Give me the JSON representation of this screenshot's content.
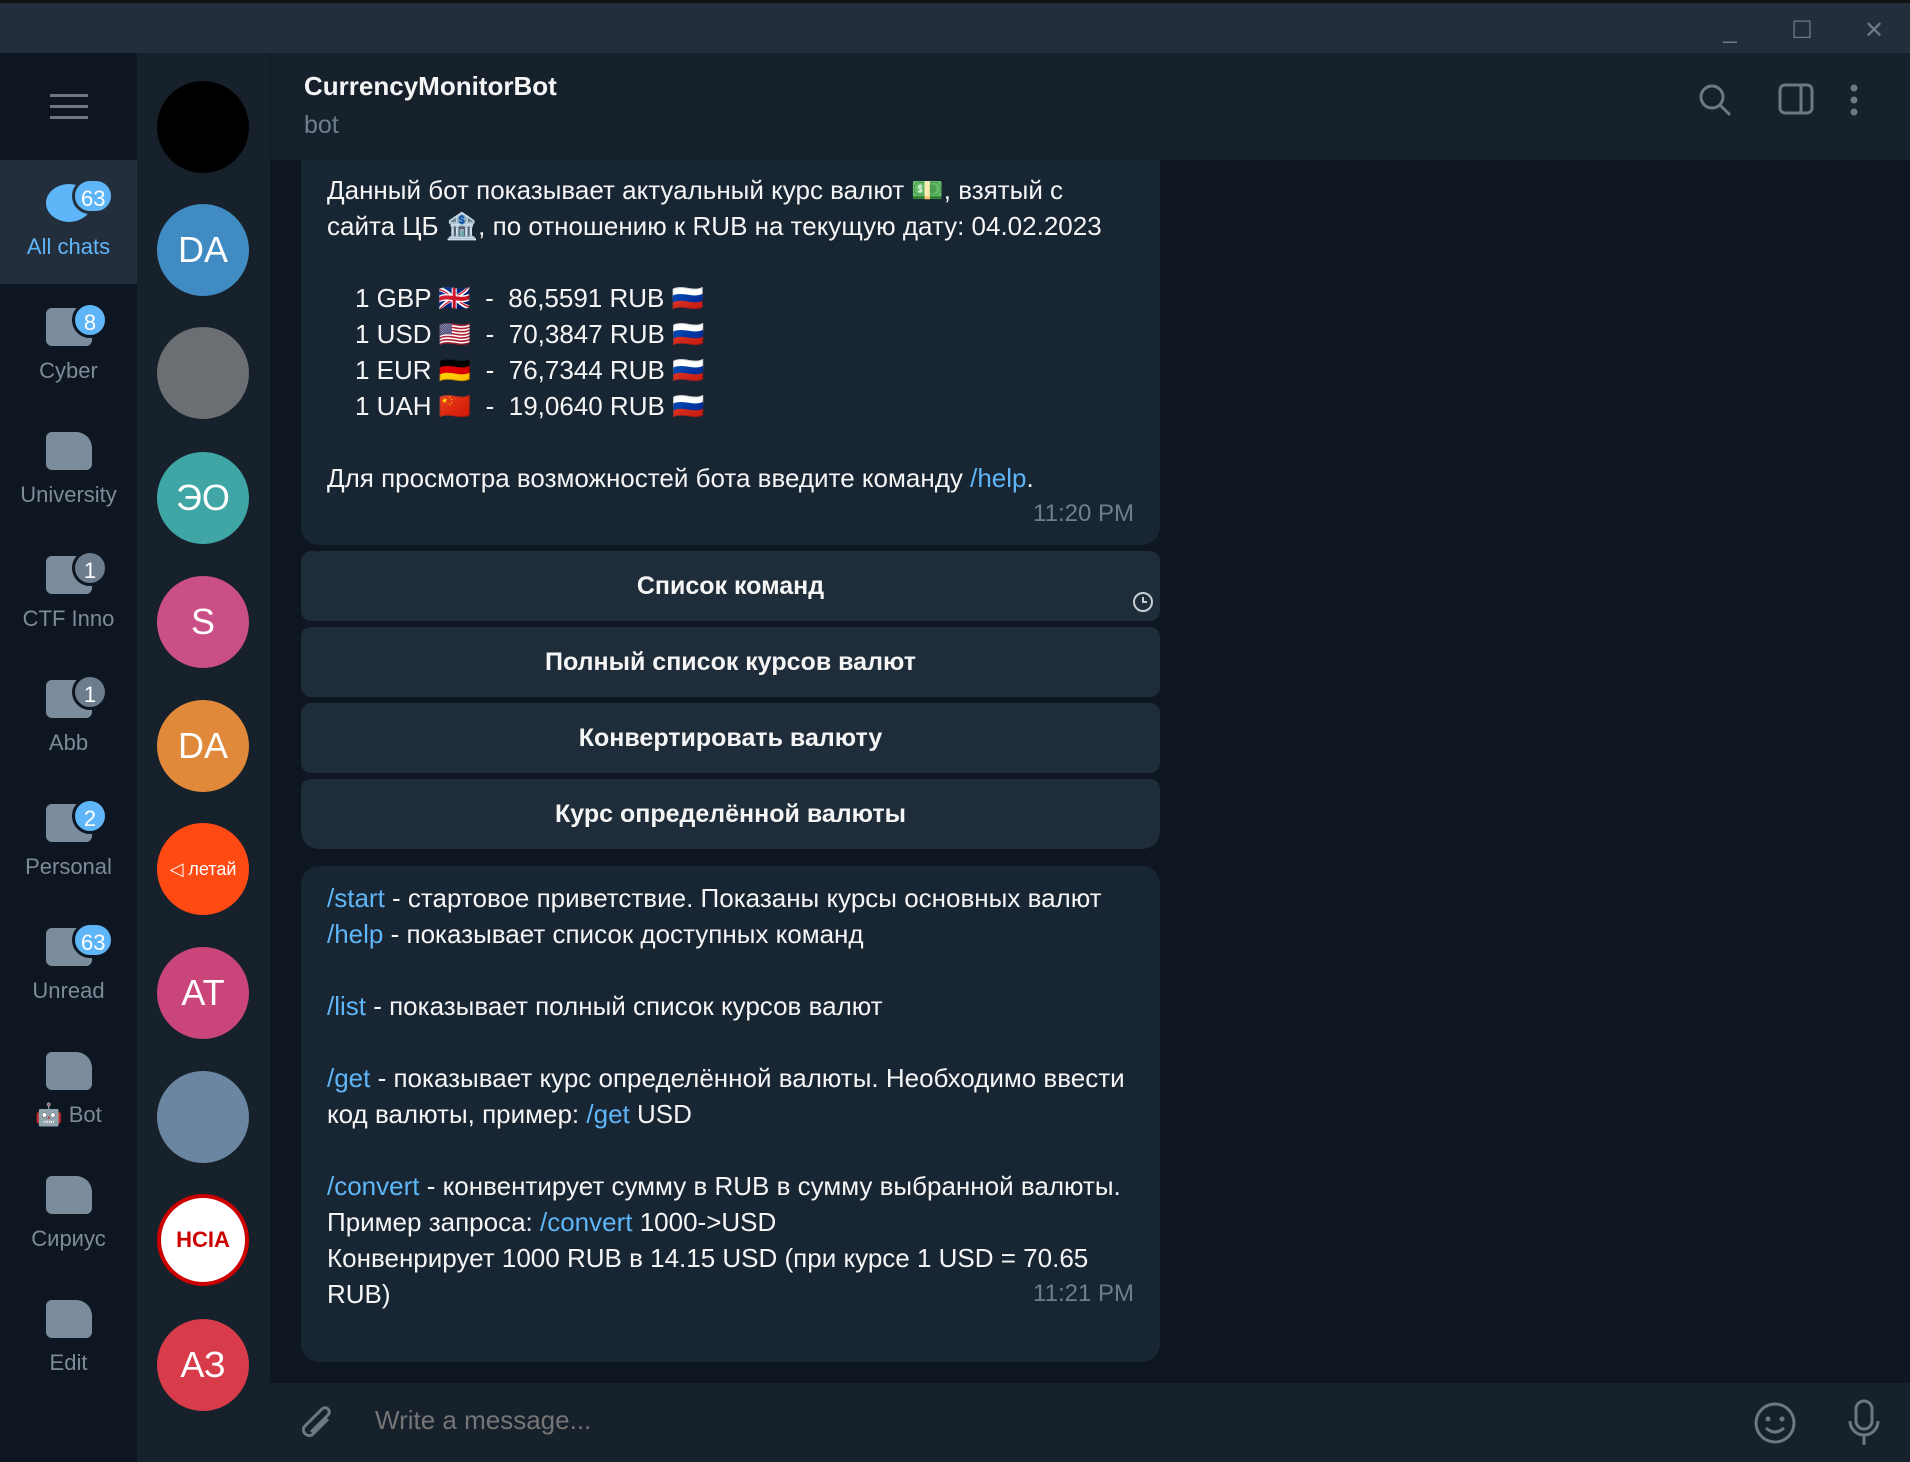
{
  "window": {
    "minimize": "_",
    "maximize": "☐",
    "close": "✕"
  },
  "folders": [
    {
      "label": "All chats",
      "badge": "63",
      "active": true
    },
    {
      "label": "Cyber",
      "badge": "8"
    },
    {
      "label": "University",
      "badge": ""
    },
    {
      "label": "CTF Inno",
      "badge": "1",
      "muted": true
    },
    {
      "label": "Abb",
      "badge": "1",
      "muted": true
    },
    {
      "label": "Personal",
      "badge": "2"
    },
    {
      "label": "Unread",
      "badge": "63"
    },
    {
      "label": "🤖 Bot",
      "badge": ""
    },
    {
      "label": "Сириус",
      "badge": ""
    },
    {
      "label": "Edit",
      "badge": ""
    }
  ],
  "chat_avatars": [
    {
      "initials": "",
      "color": "#000000"
    },
    {
      "initials": "DA",
      "color": "#3f8bc2"
    },
    {
      "initials": "",
      "color": "#6b6e72"
    },
    {
      "initials": "ЭО",
      "color": "#3fa5a5"
    },
    {
      "initials": "S",
      "color": "#cb4f87"
    },
    {
      "initials": "DA",
      "color": "#e0893a"
    },
    {
      "initials": "◁ летай",
      "color": "#ff4a14"
    },
    {
      "initials": "AT",
      "color": "#c9457a"
    },
    {
      "initials": "",
      "color": "#6a86a2"
    },
    {
      "initials": "HCIA",
      "color": "#ffffff"
    },
    {
      "initials": "АЗ",
      "color": "#d83b4a"
    }
  ],
  "header": {
    "title": "CurrencyMonitorBot",
    "subtitle": "bot"
  },
  "message1": {
    "intro_line1": "Данный бот показывает актуальный курс валют 💵, взятый с",
    "intro_line2": "сайта ЦБ 🏦, по отношению к RUB на текущую дату: 04.02.2023",
    "rates": [
      "1 GBP 🇬🇧  -  86,5591 RUB 🇷🇺",
      "1 USD 🇺🇸  -  70,3847 RUB 🇷🇺",
      "1 EUR 🇩🇪  -  76,7344 RUB 🇷🇺",
      "1 UAH 🇨🇳  -  19,0640 RUB 🇷🇺"
    ],
    "help_text": "Для просмотра возможностей бота введите команду ",
    "help_link": "/help",
    "help_end": ".",
    "time": "11:20 PM"
  },
  "keyboard": [
    "Список команд",
    "Полный список курсов валют",
    "Конвертировать валюту",
    "Курс определённой валюты"
  ],
  "message2": {
    "start_cmd": "/start",
    "start_text": " - стартовое приветствие. Показаны курсы основных валют",
    "help_cmd": "/help",
    "help_text": " - показывает список доступных команд",
    "list_cmd": "/list",
    "list_text": " - показывает полный список курсов валют",
    "get_cmd": "/get",
    "get_text": " - показывает курс определённой валюты. Необходимо ввести код валюты, пример:  ",
    "get_example_cmd": "/get",
    "get_example_arg": " USD",
    "convert_cmd": "/convert",
    "convert_text": " - конвентирует сумму в RUB в сумму выбранной валюты. Пример запроса: ",
    "convert_example_cmd": "/convert",
    "convert_example_arg": " 1000->USD",
    "convert_note": "Конвенрирует 1000 RUB в 14.15 USD (при курсе 1 USD = 70.65 RUB)",
    "time": "11:21 PM"
  },
  "input": {
    "placeholder": "Write a message..."
  }
}
